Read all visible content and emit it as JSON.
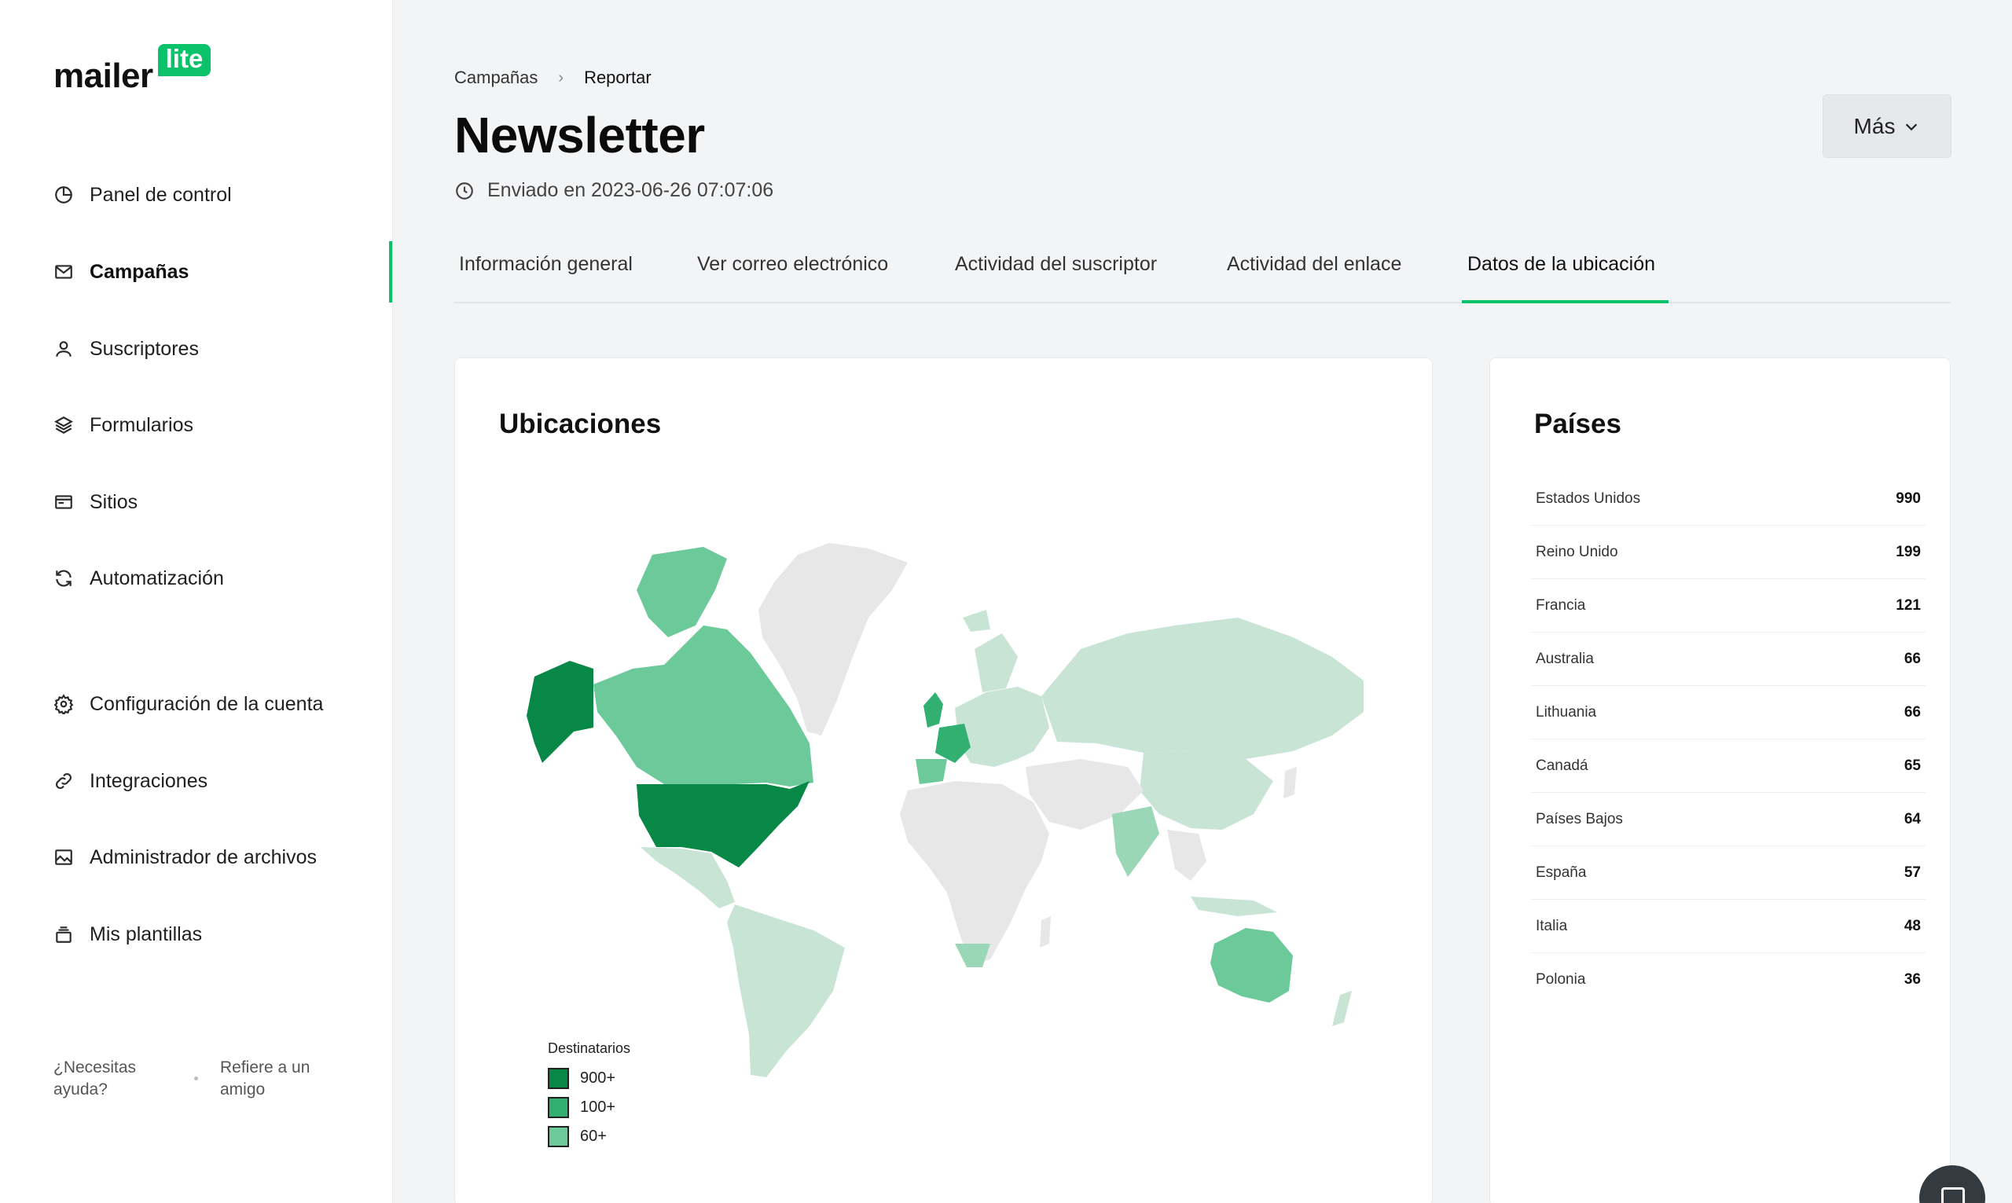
{
  "logo": {
    "text": "mailer",
    "badge": "lite"
  },
  "sidebar": {
    "items": [
      {
        "label": "Panel de control",
        "icon": "chart-pie-icon"
      },
      {
        "label": "Campañas",
        "icon": "envelope-icon"
      },
      {
        "label": "Suscriptores",
        "icon": "user-icon"
      },
      {
        "label": "Formularios",
        "icon": "layers-icon"
      },
      {
        "label": "Sitios",
        "icon": "browser-window-icon"
      },
      {
        "label": "Automatización",
        "icon": "refresh-icon"
      },
      {
        "label": "Configuración de la cuenta",
        "icon": "gear-icon"
      },
      {
        "label": "Integraciones",
        "icon": "link-icon"
      },
      {
        "label": "Administrador de archivos",
        "icon": "image-icon"
      },
      {
        "label": "Mis plantillas",
        "icon": "template-stack-icon"
      }
    ],
    "active": "Campañas",
    "help": "¿Necesitas ayuda?",
    "refer": "Refiere a un amigo"
  },
  "breadcrumb": {
    "parent": "Campañas",
    "current": "Reportar"
  },
  "page": {
    "title": "Newsletter",
    "sent": "Enviado en 2023-06-26 07:07:06",
    "more_button": "Más"
  },
  "tabs": [
    {
      "label": "Información general"
    },
    {
      "label": "Ver correo electrónico"
    },
    {
      "label": "Actividad del suscriptor"
    },
    {
      "label": "Actividad del enlace"
    },
    {
      "label": "Datos de la ubicación"
    }
  ],
  "active_tab": "Datos de la ubicación",
  "locations": {
    "title": "Ubicaciones",
    "legend_title": "Destinatarios",
    "legend": [
      {
        "label": "900+",
        "color": "#078847"
      },
      {
        "label": "100+",
        "color": "#31b072"
      },
      {
        "label": "60+",
        "color": "#6cc99a"
      }
    ],
    "colors": {
      "default": "#e7e7e7",
      "light": "#c8e4d5",
      "medium": "#9ad7b6"
    }
  },
  "countries": {
    "title": "Países",
    "rows": [
      {
        "name": "Estados Unidos",
        "value": "990"
      },
      {
        "name": "Reino Unido",
        "value": "199"
      },
      {
        "name": "Francia",
        "value": "121"
      },
      {
        "name": "Australia",
        "value": "66"
      },
      {
        "name": "Lithuania",
        "value": "66"
      },
      {
        "name": "Canadá",
        "value": "65"
      },
      {
        "name": "Países Bajos",
        "value": "64"
      },
      {
        "name": "España",
        "value": "57"
      },
      {
        "name": "Italia",
        "value": "48"
      },
      {
        "name": "Polonia",
        "value": "36"
      }
    ]
  },
  "accent": "#09c269"
}
